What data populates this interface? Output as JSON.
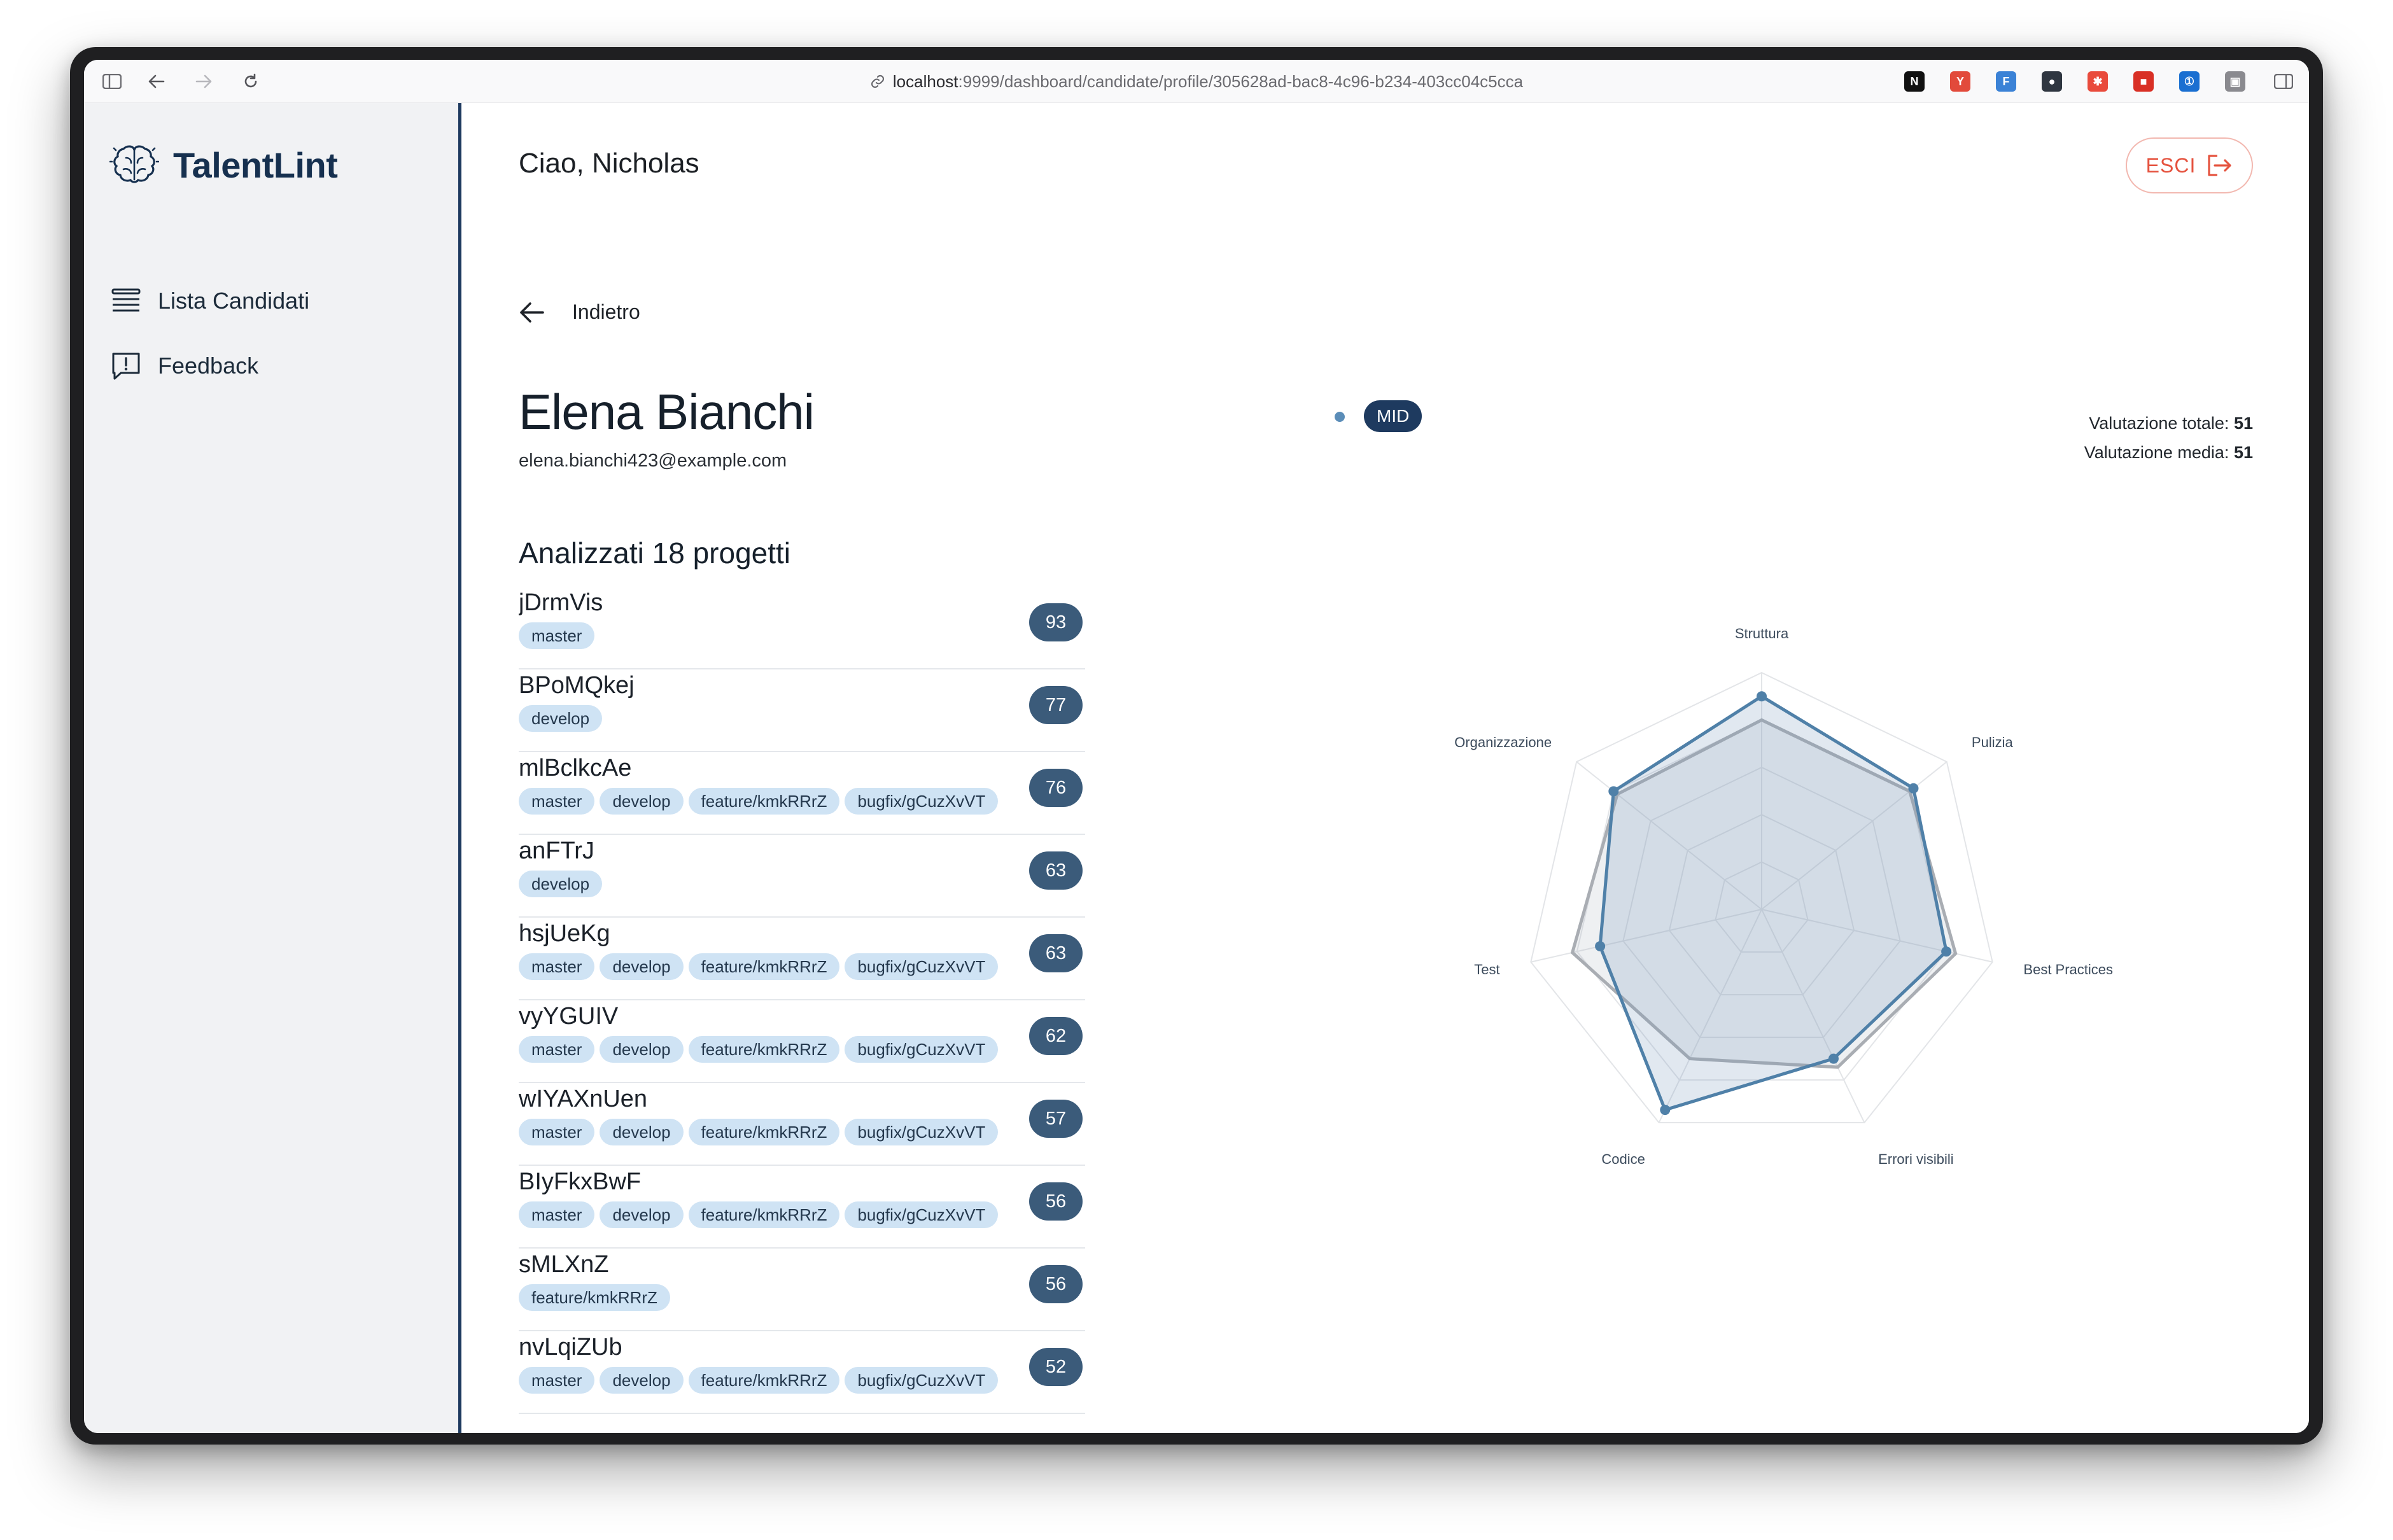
{
  "browser": {
    "url_host": "localhost",
    "url_path": ":9999/dashboard/candidate/profile/305628ad-bac8-4c96-b234-403cc04c5cca",
    "extensions": [
      {
        "name": "notion-icon",
        "glyph": "N",
        "color": "#111111"
      },
      {
        "name": "leaf-extension-icon",
        "glyph": "Y",
        "color": "#e24a3b"
      },
      {
        "name": "font-extension-icon",
        "glyph": "F",
        "color": "#3b82d6"
      },
      {
        "name": "ninja-extension-icon",
        "glyph": "●",
        "color": "#2f3640"
      },
      {
        "name": "pinwheel-extension-icon",
        "glyph": "✱",
        "color": "#e94b3c"
      },
      {
        "name": "red-extension-icon",
        "glyph": "■",
        "color": "#d93025"
      },
      {
        "name": "password-extension-icon",
        "glyph": "①",
        "color": "#1a6fd1"
      },
      {
        "name": "box-extension-icon",
        "glyph": "▣",
        "color": "#8a8a8f"
      }
    ]
  },
  "sidebar": {
    "brand": "TalentLint",
    "items": [
      {
        "label": "Lista Candidati",
        "icon": "list-icon"
      },
      {
        "label": "Feedback",
        "icon": "feedback-icon"
      }
    ]
  },
  "header": {
    "greeting": "Ciao, Nicholas",
    "logout_label": "ESCI"
  },
  "back_label": "Indietro",
  "candidate": {
    "name": "Elena Bianchi",
    "level": "MID",
    "email": "elena.bianchi423@example.com",
    "total_label": "Valutazione totale:",
    "total_value": "51",
    "avg_label": "Valutazione media:",
    "avg_value": "51"
  },
  "projects_title": "Analizzati 18 progetti",
  "projects": [
    {
      "name": "jDrmVis",
      "score": "93",
      "branches": [
        "master"
      ]
    },
    {
      "name": "BPoMQkej",
      "score": "77",
      "branches": [
        "develop"
      ]
    },
    {
      "name": "mlBclkcAe",
      "score": "76",
      "branches": [
        "master",
        "develop",
        "feature/kmkRRrZ",
        "bugfix/gCuzXvVT"
      ]
    },
    {
      "name": "anFTrJ",
      "score": "63",
      "branches": [
        "develop"
      ]
    },
    {
      "name": "hsjUeKg",
      "score": "63",
      "branches": [
        "master",
        "develop",
        "feature/kmkRRrZ",
        "bugfix/gCuzXvVT"
      ]
    },
    {
      "name": "vyYGUIV",
      "score": "62",
      "branches": [
        "master",
        "develop",
        "feature/kmkRRrZ",
        "bugfix/gCuzXvVT"
      ]
    },
    {
      "name": "wIYAXnUen",
      "score": "57",
      "branches": [
        "master",
        "develop",
        "feature/kmkRRrZ",
        "bugfix/gCuzXvVT"
      ]
    },
    {
      "name": "BIyFkxBwF",
      "score": "56",
      "branches": [
        "master",
        "develop",
        "feature/kmkRRrZ",
        "bugfix/gCuzXvVT"
      ]
    },
    {
      "name": "sMLXnZ",
      "score": "56",
      "branches": [
        "feature/kmkRRrZ"
      ]
    },
    {
      "name": "nvLqiZUb",
      "score": "52",
      "branches": [
        "master",
        "develop",
        "feature/kmkRRrZ",
        "bugfix/gCuzXvVT"
      ]
    }
  ],
  "chart_data": {
    "type": "radar",
    "axes": [
      "Struttura",
      "Pulizia",
      "Best Practices",
      "Errori visibili",
      "Codice",
      "Test",
      "Organizzazione"
    ],
    "max": 100,
    "series": [
      {
        "color": "#4f80a8",
        "values": [
          90,
          82,
          80,
          70,
          94,
          70,
          80
        ]
      },
      {
        "color": "#a9adb3",
        "values": [
          80,
          80,
          84,
          74,
          70,
          82,
          78
        ]
      }
    ],
    "grid_levels": 5
  }
}
